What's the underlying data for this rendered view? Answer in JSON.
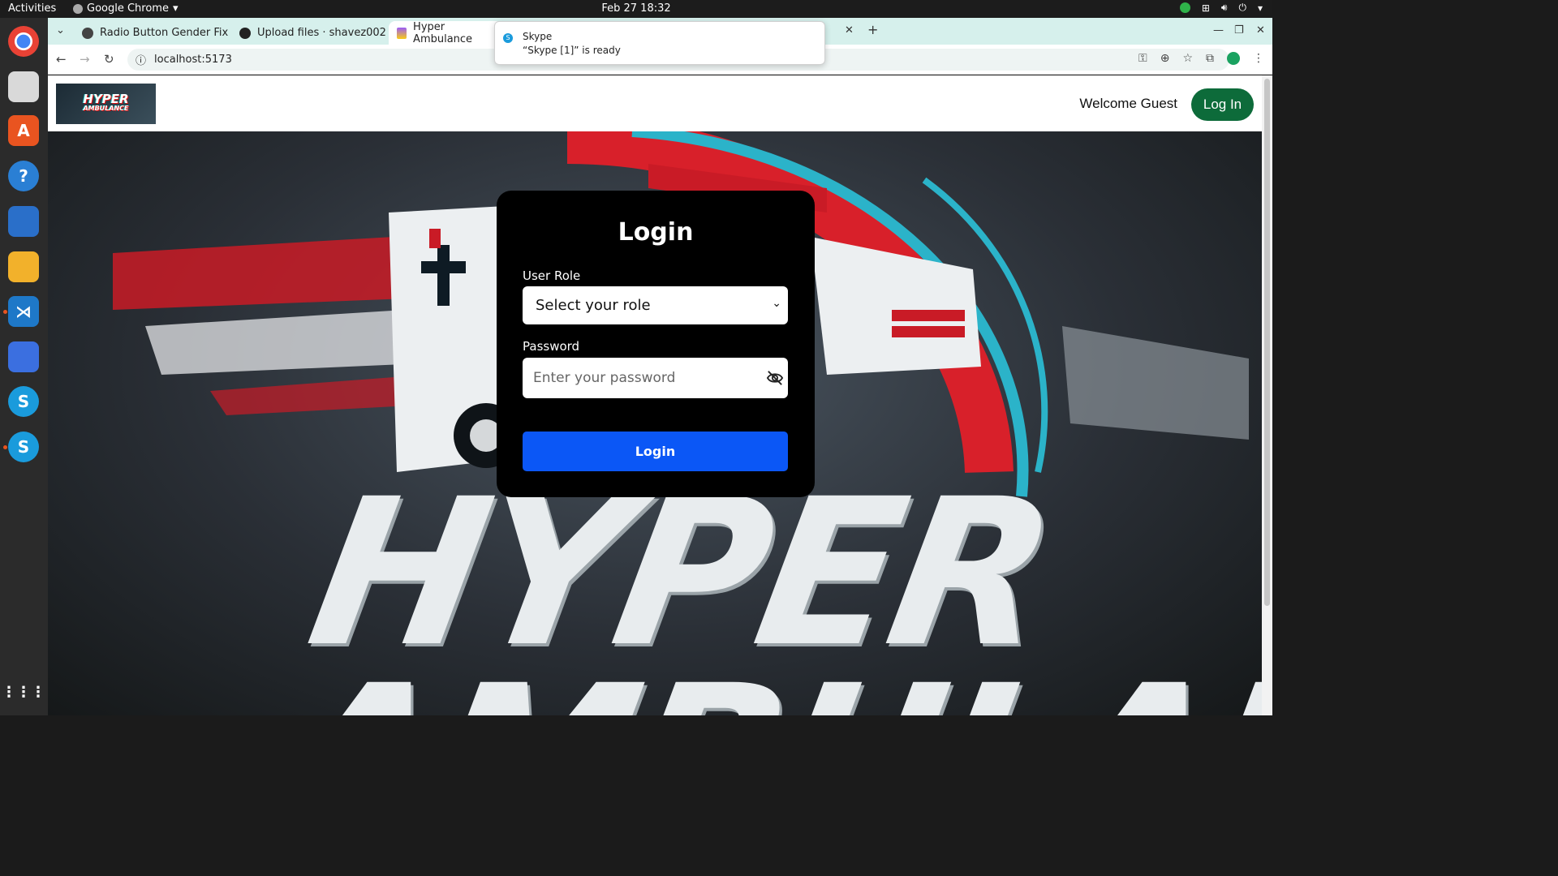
{
  "os": {
    "activities": "Activities",
    "app_menu": "Google Chrome",
    "clock": "Feb 27  18:32"
  },
  "browser": {
    "tabs": [
      {
        "title": "Radio Button Gender Fix"
      },
      {
        "title": "Upload files · shavez002"
      },
      {
        "title": "Hyper Ambulance"
      }
    ],
    "url": "localhost:5173"
  },
  "notification": {
    "app": "Skype",
    "message": "“Skype [1]” is ready"
  },
  "header": {
    "logo_line1": "HYPER",
    "logo_line2": "AMBULANCE",
    "welcome": "Welcome Guest",
    "login_button": "Log In"
  },
  "login_card": {
    "title": "Login",
    "role_label": "User Role",
    "role_value": "Select your role",
    "password_label": "Password",
    "password_placeholder": "Enter your password",
    "submit": "Login"
  },
  "hero": {
    "line1": "HYPER",
    "line2": "AMBULANCE"
  },
  "colors": {
    "accent_blue": "#0b57f6",
    "header_button_green": "#0d6b3a",
    "tab_strip": "#d6f0ec"
  }
}
